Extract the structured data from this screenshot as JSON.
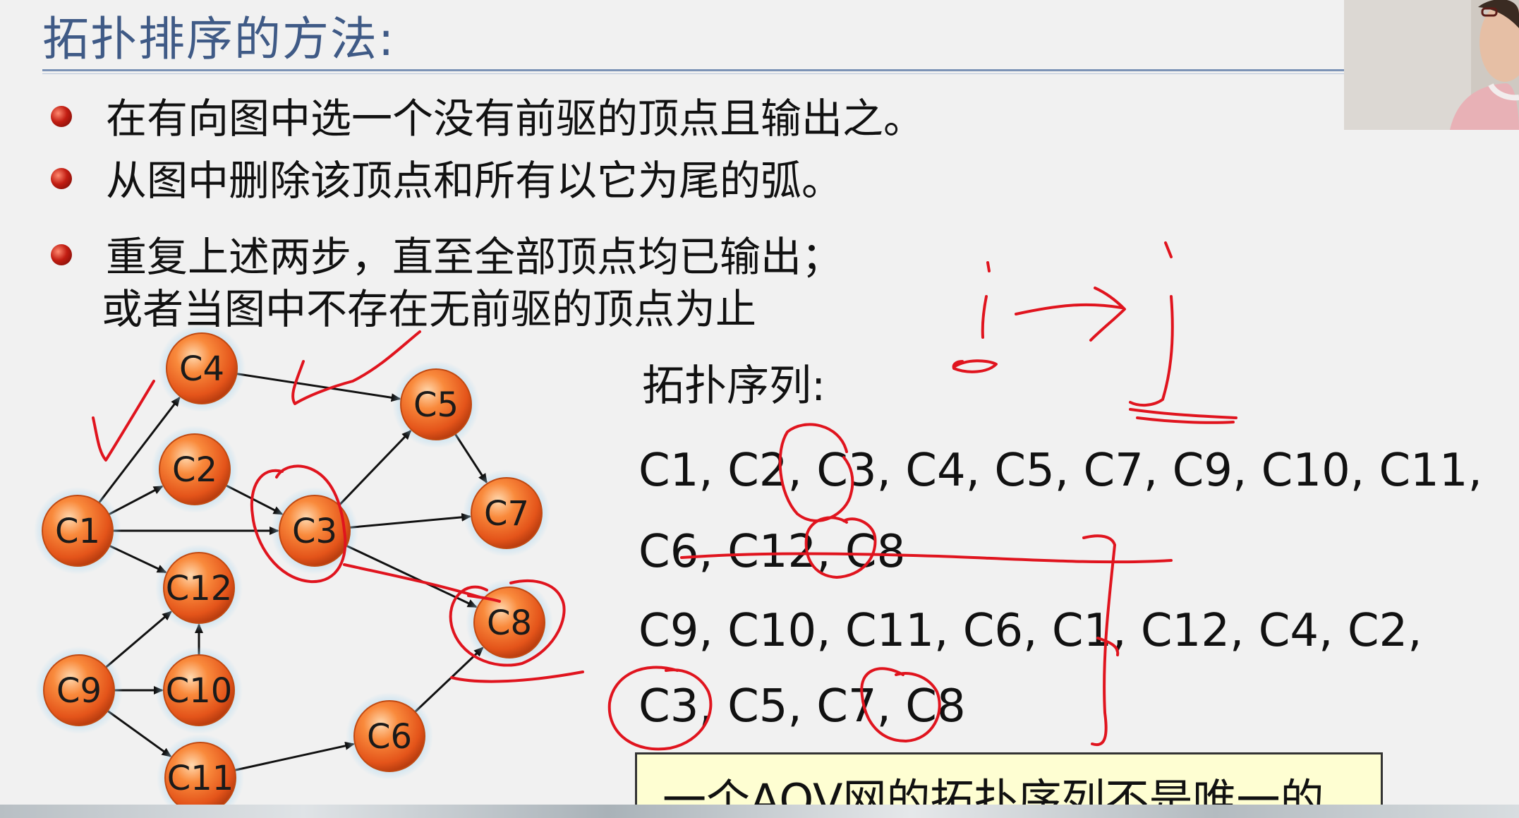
{
  "slide": {
    "title": "拓扑排序的方法:",
    "bullets": [
      "在有向图中选一个没有前驱的顶点且输出之。",
      "从图中删除该顶点和所有以它为尾的弧。",
      "重复上述两步，直至全部顶点均已输出；"
    ],
    "bullet3_continuation": "或者当图中不存在无前驱的顶点为止",
    "sequence_title": "拓扑序列:",
    "sequences": [
      {
        "line1": "C1, C2, C3, C4, C5, C7, C9, C10,  C11,",
        "line2": "C6, C12, C8"
      },
      {
        "line1": "C9, C10, C11, C6, C1, C12, C4, C2,",
        "line2": "C3, C5, C7, C8"
      }
    ],
    "note": "一个AOV网的拓扑序列不是唯一的"
  },
  "graph": {
    "nodes": [
      {
        "id": "C1",
        "label": "C1"
      },
      {
        "id": "C2",
        "label": "C2"
      },
      {
        "id": "C3",
        "label": "C3"
      },
      {
        "id": "C4",
        "label": "C4"
      },
      {
        "id": "C5",
        "label": "C5"
      },
      {
        "id": "C6",
        "label": "C6"
      },
      {
        "id": "C7",
        "label": "C7"
      },
      {
        "id": "C8",
        "label": "C8"
      },
      {
        "id": "C9",
        "label": "C9"
      },
      {
        "id": "C10",
        "label": "C10"
      },
      {
        "id": "C11",
        "label": "C11"
      },
      {
        "id": "C12",
        "label": "C12"
      }
    ],
    "edges": [
      [
        "C1",
        "C4"
      ],
      [
        "C1",
        "C2"
      ],
      [
        "C1",
        "C3"
      ],
      [
        "C1",
        "C12"
      ],
      [
        "C2",
        "C3"
      ],
      [
        "C4",
        "C5"
      ],
      [
        "C3",
        "C5"
      ],
      [
        "C3",
        "C7"
      ],
      [
        "C3",
        "C8"
      ],
      [
        "C5",
        "C7"
      ],
      [
        "C9",
        "C12"
      ],
      [
        "C9",
        "C10"
      ],
      [
        "C9",
        "C11"
      ],
      [
        "C10",
        "C12"
      ],
      [
        "C11",
        "C6"
      ],
      [
        "C6",
        "C8"
      ]
    ]
  },
  "colors": {
    "title": "#3f5a86",
    "node_fill": "#f26a22",
    "ink": "#e0141e",
    "note_bg": "#fefed2"
  },
  "icons": {
    "bullet": "red-sphere-bullet-icon"
  }
}
